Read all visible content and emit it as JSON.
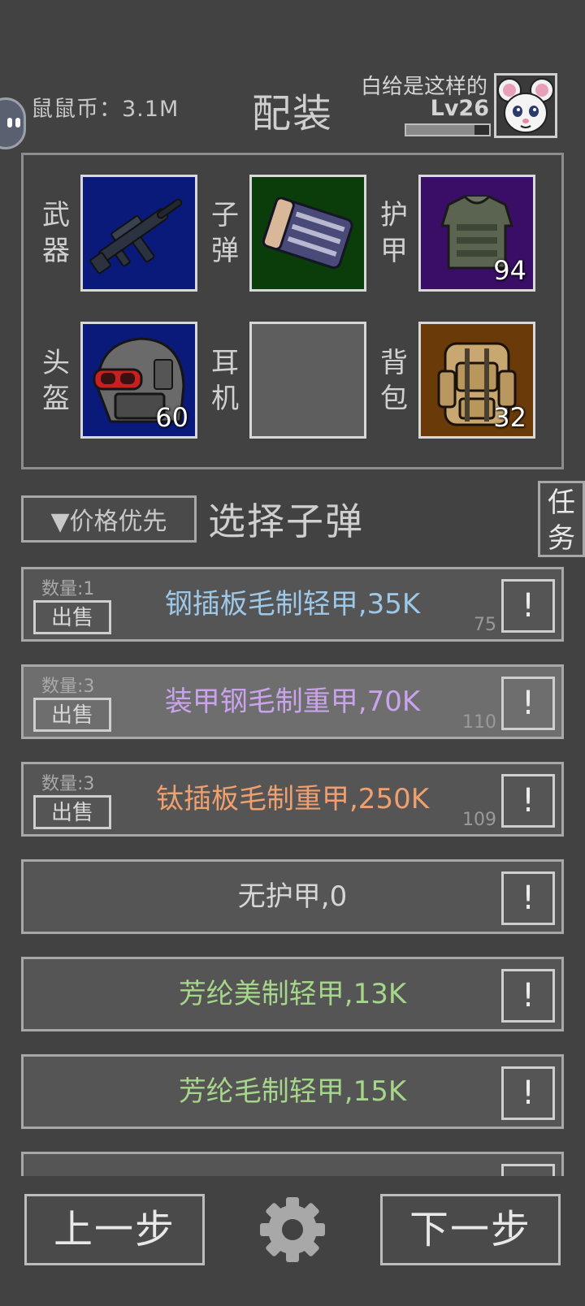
{
  "header": {
    "coins_label": "鼠鼠币：",
    "coins_value": "3.1M",
    "title": "配装",
    "player_name": "白给是这样的",
    "player_level": "Lv26",
    "xp_fraction": 0.82
  },
  "equipment": {
    "weapon": {
      "label": "武器"
    },
    "ammo": {
      "label": "子弹"
    },
    "armor": {
      "label": "护甲",
      "count": "94"
    },
    "helmet": {
      "label": "头盔",
      "count": "60"
    },
    "headset": {
      "label": "耳机"
    },
    "backpack": {
      "label": "背包",
      "count": "32"
    }
  },
  "toolbar": {
    "sort_label": "▼价格优先",
    "section_title": "选择子弹",
    "task_label_1": "任",
    "task_label_2": "务"
  },
  "items": [
    {
      "qty": "数量:1",
      "sell": "出售",
      "name": "钢插板毛制轻甲,35K",
      "value": "75",
      "color": "#9ec8e8",
      "info": "!"
    },
    {
      "qty": "数量:3",
      "sell": "出售",
      "name": "装甲钢毛制重甲,70K",
      "value": "110",
      "color": "#c9a4ec",
      "info": "!"
    },
    {
      "qty": "数量:3",
      "sell": "出售",
      "name": "钛插板毛制重甲,250K",
      "value": "109",
      "color": "#f0a070",
      "info": "!"
    },
    {
      "name": "无护甲,0",
      "color": "#d6d6d6",
      "info": "!"
    },
    {
      "name": "芳纶美制轻甲,13K",
      "color": "#a6d68a",
      "info": "!"
    },
    {
      "name": "芳纶毛制轻甲,15K",
      "color": "#a6d68a",
      "info": "!"
    }
  ],
  "footer": {
    "prev_label": "上一步",
    "next_label": "下一步"
  },
  "colors": {
    "background": "#424242",
    "weapon_bg": "#0a1a7a",
    "ammo_bg": "#0b3d0b",
    "armor_bg": "#3a0e66",
    "helmet_bg": "#0a1a7a",
    "headset_bg": "#5e5e5e",
    "backpack_bg": "#6a3a08"
  },
  "icons": [
    "robot-face-icon",
    "rifle-icon",
    "ammo-box-icon",
    "vest-icon",
    "helmet-icon",
    "backpack-icon",
    "gear-icon"
  ]
}
